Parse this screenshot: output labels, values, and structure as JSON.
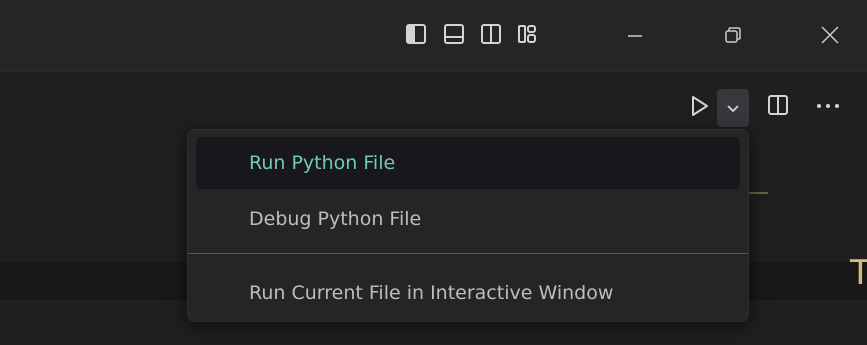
{
  "titlebar": {
    "layout_icons": [
      "toggle-primary-sidebar-icon",
      "toggle-panel-icon",
      "toggle-secondary-sidebar-icon",
      "customize-layout-icon"
    ],
    "window_controls": [
      "minimize-icon",
      "restore-icon",
      "close-icon"
    ]
  },
  "editor_toolbar": {
    "icons": [
      "run-icon",
      "chevron-down-icon",
      "split-editor-icon",
      "more-actions-icon"
    ]
  },
  "run_menu": {
    "items": [
      {
        "label": "Run Python File",
        "highlighted": true
      },
      {
        "label": "Debug Python File",
        "highlighted": false
      },
      {
        "label": "Run Current File in Interactive Window",
        "highlighted": false
      }
    ]
  },
  "colors": {
    "highlight_text": "#73c9b6",
    "menu_text": "#bdbdbd",
    "menu_bg": "#252526"
  }
}
